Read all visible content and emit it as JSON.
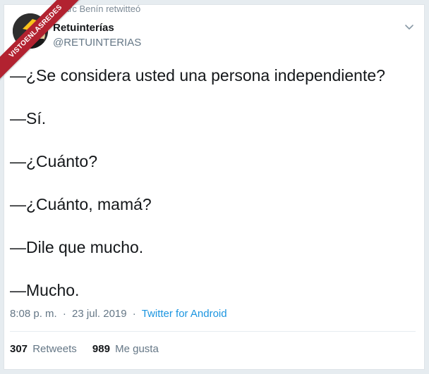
{
  "retweet_context": "Marc Benín retwitteó",
  "watermark": "VISTOENLASREDES",
  "author": {
    "display_name": "Retuinterías",
    "handle": "@RETUINTERIAS"
  },
  "tweet": {
    "lines": [
      "—¿Se considera usted una persona independiente?",
      "—Sí.",
      "—¿Cuánto?",
      "—¿Cuánto, mamá?",
      "—Dile que mucho.",
      "—Mucho."
    ],
    "time": "8:08 p. m.",
    "date": "23 jul. 2019",
    "separator": "·",
    "source": "Twitter for Android"
  },
  "stats": {
    "retweets_count": "307",
    "retweets_label": "Retweets",
    "likes_count": "989",
    "likes_label": "Me gusta"
  },
  "colors": {
    "link": "#1b95e0",
    "secondary_text": "#657786",
    "ribbon": "#b22230"
  }
}
